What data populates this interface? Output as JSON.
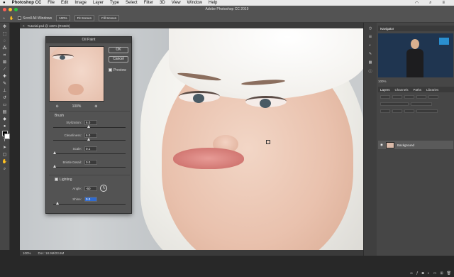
{
  "menubar": {
    "apple": "",
    "items": [
      "Photoshop CC",
      "File",
      "Edit",
      "Image",
      "Layer",
      "Type",
      "Select",
      "Filter",
      "3D",
      "View",
      "Window",
      "Help"
    ]
  },
  "optionsbar": {
    "app_title": "Adobe Photoshop CC 2019",
    "scroll_all": "Scroll All Windows",
    "zoom_100": "100%",
    "fit_screen": "Fit Screen",
    "fill_screen": "Fill Screen"
  },
  "document": {
    "tab": "Tutorial.psd @ 100% (RGB/8)"
  },
  "dialog": {
    "title": "Oil Paint",
    "ok": "OK",
    "cancel": "Cancel",
    "preview": "Preview",
    "zoom": "100%",
    "brush_section": "Brush",
    "stylization_label": "Stylization:",
    "stylization_value": "6.0",
    "cleanliness_label": "Cleanliness:",
    "cleanliness_value": "6.0",
    "scale_label": "Scale:",
    "scale_value": "0.1",
    "bristle_label": "Bristle Detail:",
    "bristle_value": "0.0",
    "lighting_section": "Lighting",
    "angle_label": "Angle:",
    "angle_value": "-60",
    "shine_label": "Shine:",
    "shine_value": "0.0"
  },
  "statusbar": {
    "zoom": "100%",
    "doc": "Doc: 18.9M/23.6M"
  },
  "panels": {
    "navigator_tab": "Navigator",
    "nav_zoom": "100%",
    "layers_tab": "Layers",
    "channels_tab": "Channels",
    "paths_tab": "Paths",
    "libraries_tab": "Libraries",
    "layer_name": "Background"
  },
  "colors": {
    "accent": "#2f6bd1",
    "panel_bg": "#464646",
    "dialog_bg": "#535353"
  }
}
